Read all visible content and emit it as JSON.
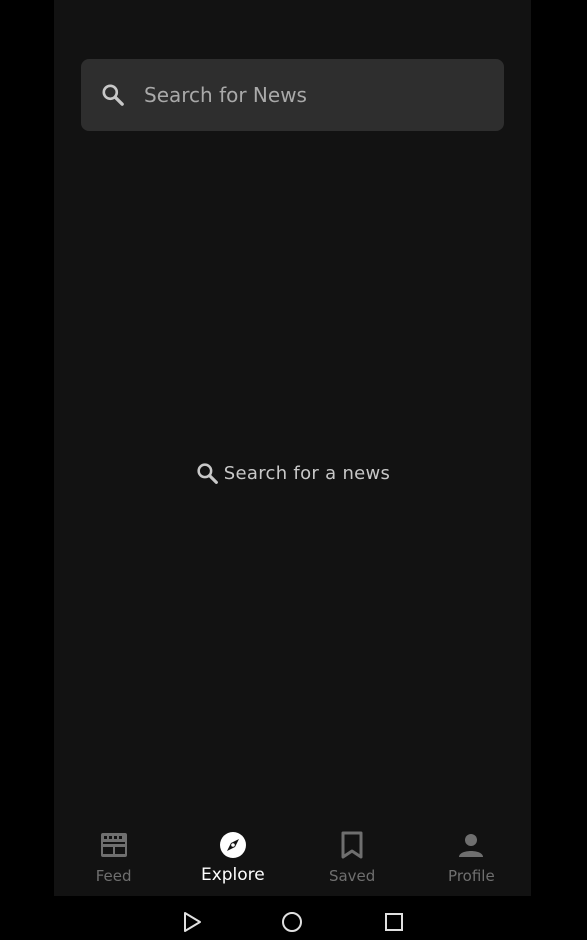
{
  "search": {
    "placeholder": "Search for News",
    "icon": "search-icon"
  },
  "empty_state": {
    "text": "Search for a news",
    "icon": "search-icon"
  },
  "bottom_nav": {
    "active": "Explore",
    "items": [
      {
        "label": "Feed",
        "icon": "feed-icon"
      },
      {
        "label": "Explore",
        "icon": "compass-icon"
      },
      {
        "label": "Saved",
        "icon": "bookmark-icon"
      },
      {
        "label": "Profile",
        "icon": "person-icon"
      }
    ]
  },
  "system_nav": {
    "buttons": [
      "back-triangle-icon",
      "home-circle-icon",
      "recents-square-icon"
    ]
  },
  "colors": {
    "background": "#000000",
    "surface": "#121212",
    "search_bar": "#2e2e2e",
    "inactive": "#6f6f6f",
    "active": "#ffffff"
  }
}
